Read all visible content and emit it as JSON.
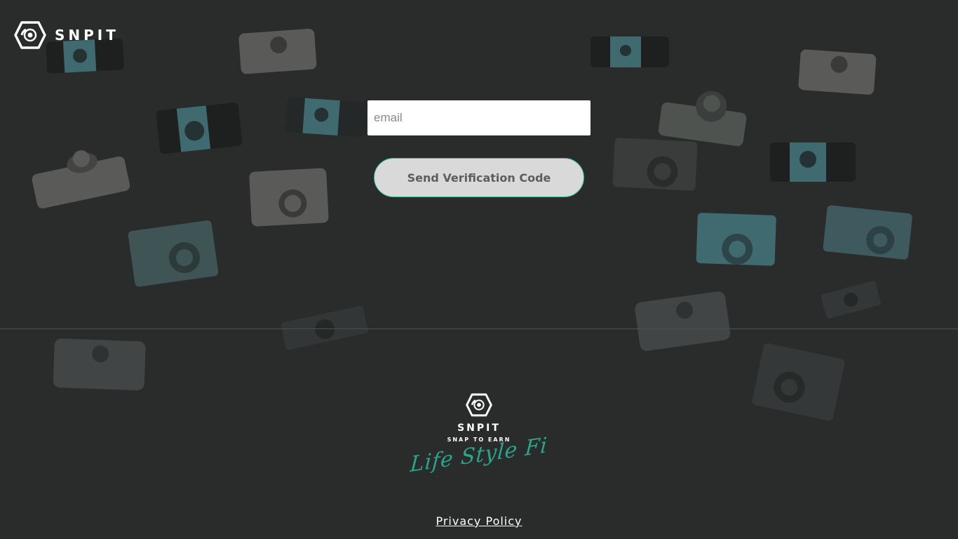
{
  "header": {
    "logo_text": "SNPIT"
  },
  "form": {
    "email_placeholder": "email",
    "email_value": "",
    "send_button_label": "Send Verification Code"
  },
  "footer": {
    "brand_name": "SNPIT",
    "tagline": "SNAP TO EARN",
    "script_text": "Life Style Fi",
    "privacy_label": "Privacy Policy"
  },
  "colors": {
    "background": "#2a2c2c",
    "accent": "#2fb89a",
    "script_accent": "#2aa58c",
    "button_bg": "#d9d9d9"
  },
  "icons": {
    "logo": "snpit-hexagon-lens-icon",
    "background": "camera-icon"
  }
}
